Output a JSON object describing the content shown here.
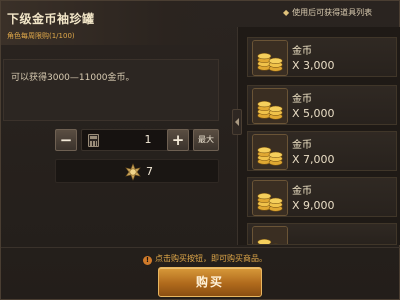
{
  "header": {
    "title": "下级金币袖珍罐",
    "limit": "角色每周限购(1/100)"
  },
  "top_hint": "使用后可获得道具列表",
  "description": "可以获得3000—11000金币。",
  "quantity": {
    "minus_label": "−",
    "value": "1",
    "plus_label": "+",
    "max_label": "最大"
  },
  "price": {
    "icon": "gold-medal-icon",
    "value": "7"
  },
  "rewards": [
    {
      "name": "金币",
      "amount": "X 3,000"
    },
    {
      "name": "金币",
      "amount": "X 5,000"
    },
    {
      "name": "金币",
      "amount": "X 7,000"
    },
    {
      "name": "金币",
      "amount": "X 9,000"
    }
  ],
  "footer": {
    "hint": "点击购买按钮，即可购买商品。",
    "buy_label": "购买"
  },
  "colors": {
    "accent": "#e0a84a",
    "buy_button": "#b06a1c",
    "background": "#231e1a"
  }
}
